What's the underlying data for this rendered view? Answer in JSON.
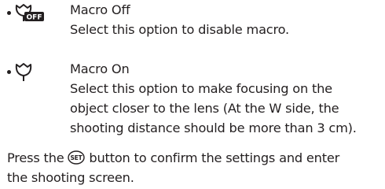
{
  "options": [
    {
      "icon": "macro-off-icon",
      "title": "Macro Off",
      "description_lines": [
        "Select this option to disable macro."
      ]
    },
    {
      "icon": "macro-on-icon",
      "title": "Macro On",
      "description_lines": [
        "Select this option to make focusing on the",
        "object closer to the lens (At the W side, the",
        "shooting distance should be more than 3 cm)."
      ]
    }
  ],
  "footer": {
    "before_icon": "Press the ",
    "button_icon": "set-button-icon",
    "button_icon_text": "SET",
    "after_icon": " button to confirm the settings and enter",
    "line2": "the shooting screen."
  }
}
